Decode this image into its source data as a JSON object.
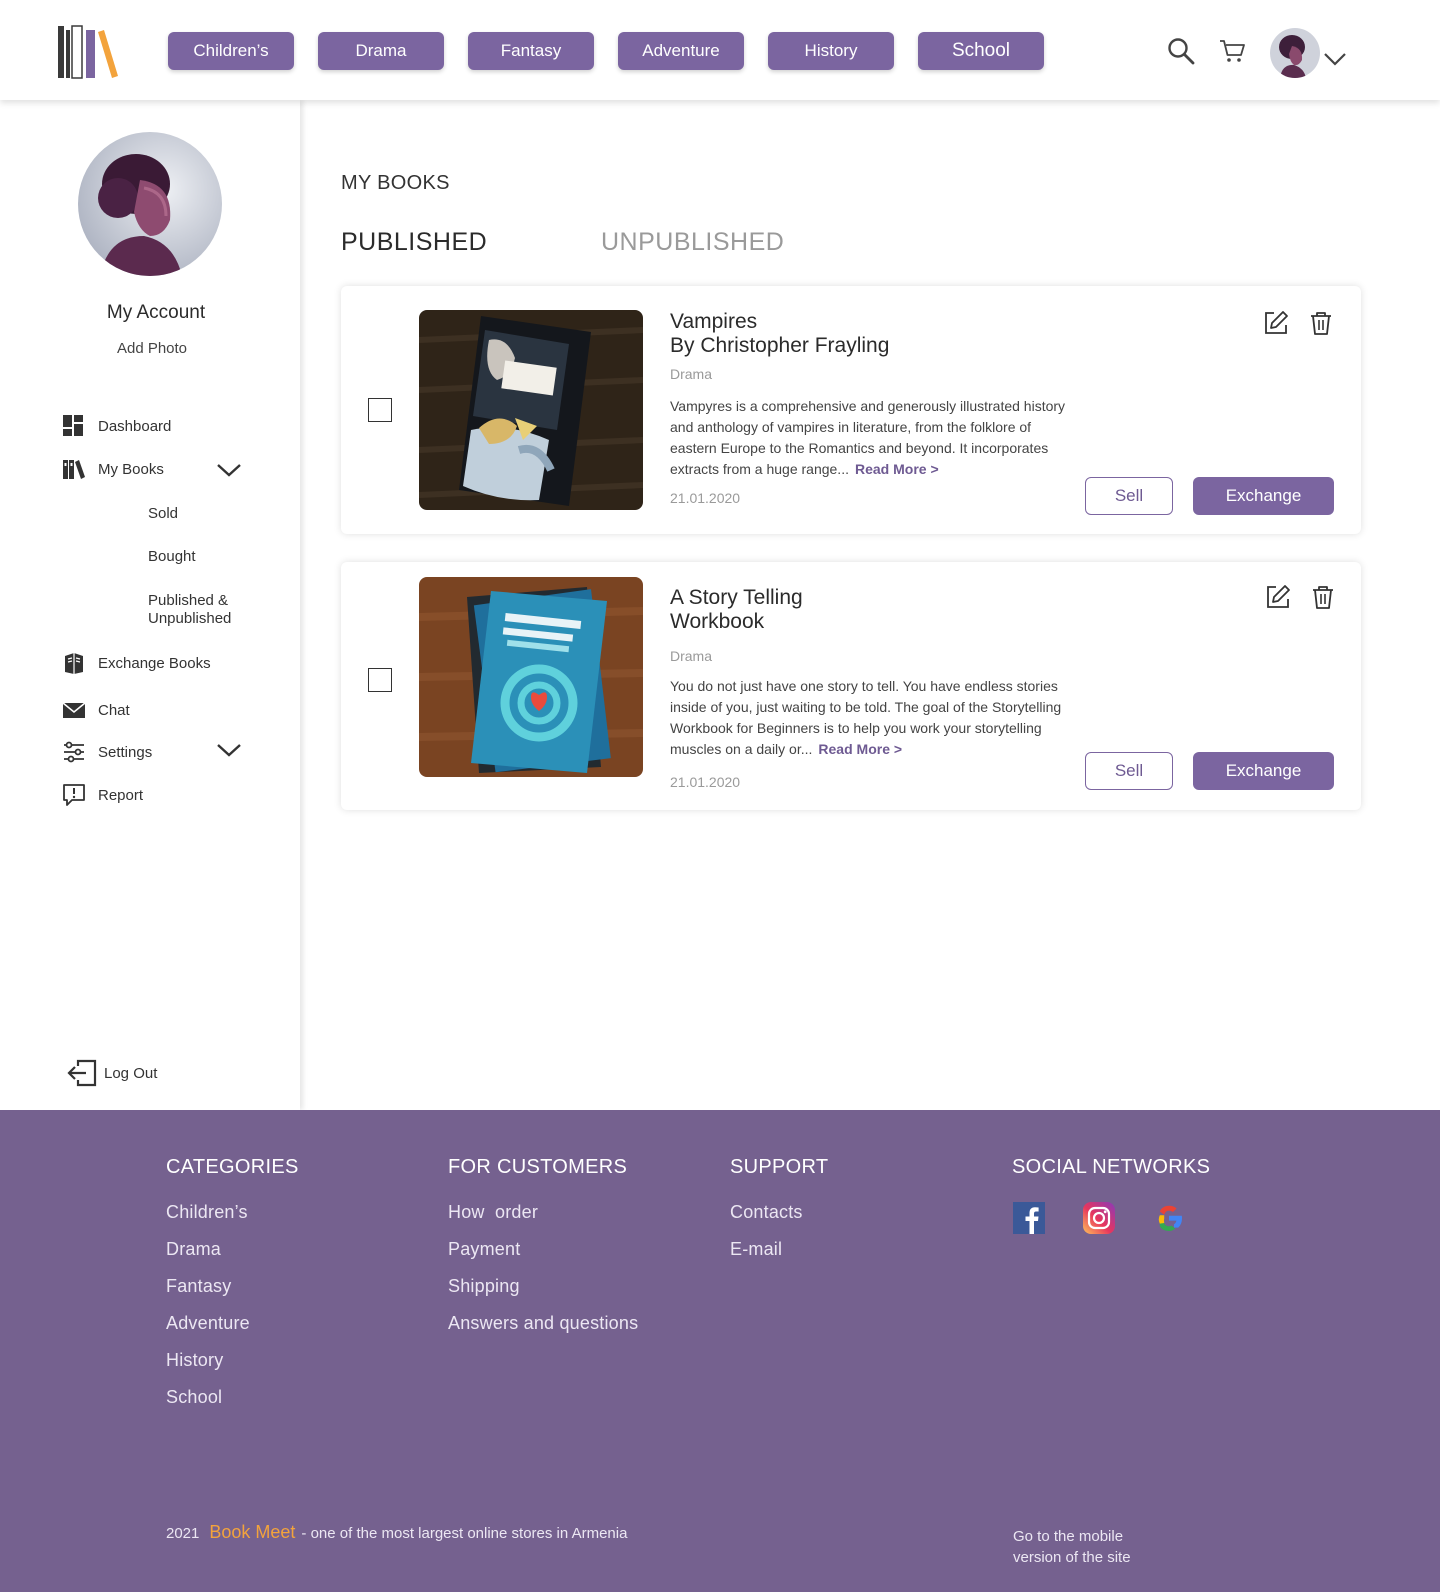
{
  "header": {
    "categories": [
      "Children’s",
      "Drama",
      "Fantasy",
      "Adventure",
      "History",
      "School"
    ],
    "brand_color": "#7b65a0",
    "icons": [
      "search-icon",
      "cart-icon",
      "avatar",
      "chevron-down-icon"
    ]
  },
  "sidebar": {
    "account_title": "My Account",
    "add_photo": "Add Photo",
    "items": [
      {
        "label": "Dashboard",
        "icon": "dashboard-icon"
      },
      {
        "label": "My Books",
        "icon": "books-icon"
      },
      {
        "label": "Exchange Books",
        "icon": "exchange-books-icon"
      },
      {
        "label": "Chat",
        "icon": "mail-icon"
      },
      {
        "label": "Settings",
        "icon": "sliders-icon"
      },
      {
        "label": "Report",
        "icon": "report-icon"
      }
    ],
    "sub_items": [
      "Sold",
      "Bought",
      "Published & Unpublished"
    ],
    "logout": "Log Out"
  },
  "main": {
    "page_title": "MY BOOKS",
    "tabs": {
      "published": "PUBLISHED",
      "unpublished": "UNPUBLISHED"
    },
    "books": [
      {
        "title": "Vampires\nBy Christopher Frayling",
        "genre": "Drama",
        "description": "Vampyres is a comprehensive and generously illustrated history and anthology of vampires in literature, from the folklore of eastern Europe to the Romantics and beyond. It incorporates extracts from a huge range...",
        "read_more": "Read More >",
        "date": "21.01.2020",
        "sell": "Sell",
        "exchange": "Exchange"
      },
      {
        "title": "A Story Telling\nWorkbook",
        "genre": "Drama",
        "description": "You do not just have one story to tell. You have endless stories inside of you, just waiting to be told. The goal of the Storytelling Workbook for Beginners is to help you work your storytelling muscles on a daily or...",
        "read_more": "Read More >",
        "date": "21.01.2020",
        "sell": "Sell",
        "exchange": "Exchange"
      }
    ]
  },
  "footer": {
    "columns": {
      "categories": {
        "heading": "CATEGORIES",
        "links": [
          "Children’s",
          "Drama",
          "Fantasy",
          "Adventure",
          "History",
          "School"
        ]
      },
      "customers": {
        "heading": "FOR CUSTOMERS",
        "links": [
          "How  order",
          "Payment",
          "Shipping",
          "Answers and questions"
        ]
      },
      "support": {
        "heading": "SUPPORT",
        "links": [
          "Contacts",
          "E-mail"
        ]
      },
      "social": {
        "heading": "SOCIAL NETWORKS",
        "icons": [
          "facebook-icon",
          "instagram-icon",
          "google-icon"
        ]
      }
    },
    "copyright_year": "2021",
    "brand": "Book Meet",
    "tagline": "- one of the most largest online stores in Armenia",
    "mobile_link": "Go to the mobile version of the site",
    "background_color": "#75618f",
    "brand_color": "#f3a33c"
  }
}
